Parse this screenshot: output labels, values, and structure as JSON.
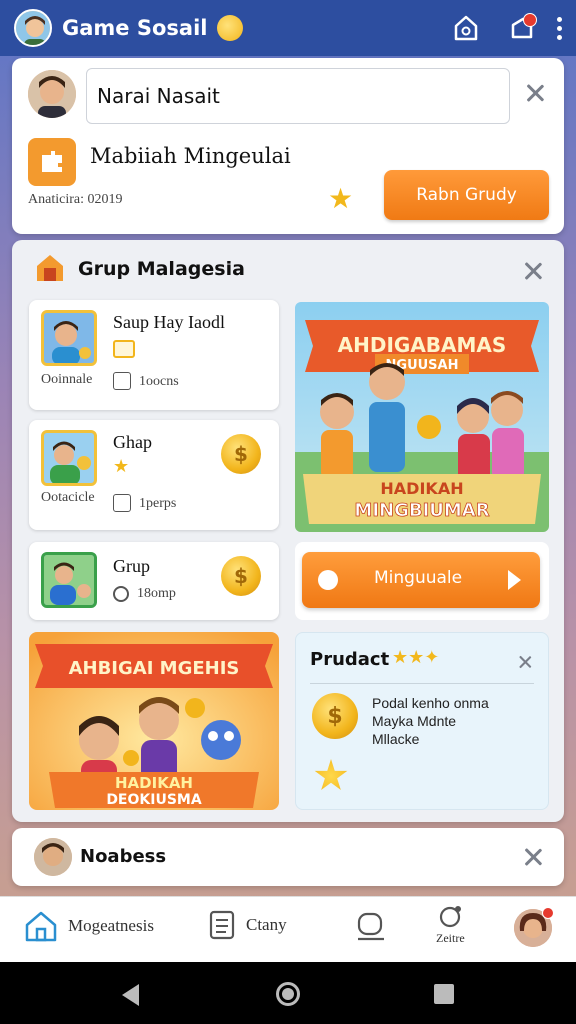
{
  "topbar": {
    "app_title": "Game Sosail"
  },
  "card_top": {
    "name_value": "Narai Nasait",
    "heading": "Mabiiah Mingeulai",
    "sub": "Anaticira: 02019",
    "button_label": "Rabn Grudy"
  },
  "group_card": {
    "title": "Grup Malagesia",
    "groups": [
      {
        "title": "Saup Hay Iaodl",
        "caption": "Ooinnale",
        "meta": "1oocns"
      },
      {
        "title": "Ghap",
        "caption": "Ootacicle",
        "meta": "1perps"
      },
      {
        "title": "Grup",
        "meta": "18omp"
      }
    ],
    "banner_right": {
      "top_text": "AHDIGABAMAS",
      "ribbon_text": "NGUUSAH",
      "bottom_line1": "HADIKAH",
      "bottom_line2": "MINGBIUMAR"
    },
    "mingu_button": "Minguuale",
    "banner_left": {
      "top_text": "AHBIGAI MGEHIS",
      "bottom_line1": "HADIKAH",
      "bottom_line2": "DEOKIUSMA"
    },
    "product": {
      "title": "Prudact",
      "lines": [
        "Podal kenho onma",
        "Mayka Mdnte",
        "Mllacke"
      ]
    }
  },
  "card_bottom": {
    "title": "Noabess"
  },
  "bottomnav": {
    "item1": "Mogeatnesis",
    "item2": "Ctany",
    "item4": "Zeitre"
  },
  "colors": {
    "accent": "#f07a14",
    "topbar": "#2d4ea0",
    "coin": "#f2b51c"
  }
}
